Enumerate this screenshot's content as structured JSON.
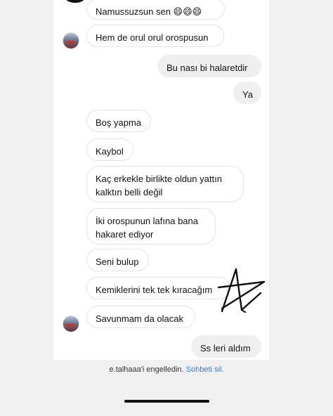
{
  "messages": [
    {
      "text": "Namussuzsun sen 😄😄😄",
      "dir": "in"
    },
    {
      "text": "Hem de orul orul orospusun",
      "dir": "in"
    },
    {
      "text": "Bu nası bi halaretdir",
      "dir": "out"
    },
    {
      "text": "Ya",
      "dir": "out"
    },
    {
      "text": "Boş yapma",
      "dir": "in"
    },
    {
      "text": "Kaybol",
      "dir": "in"
    },
    {
      "text": "Kaç erkekle birlikte oldun yattın\nkalktın belli değil",
      "dir": "in"
    },
    {
      "text": "İki orospunun lafına bana\nhakaret ediyor",
      "dir": "in"
    },
    {
      "text": "Seni bulup",
      "dir": "in"
    },
    {
      "text": "Kemiklerini tek tek kıracağım",
      "dir": "in"
    },
    {
      "text": "Savunmam da olacak",
      "dir": "in"
    },
    {
      "text": "Ss leri aldım",
      "dir": "out"
    }
  ],
  "footer": {
    "blocked_text": "e.talhaaa'i engelledin.",
    "delete_chat_label": "Sohbeti sil."
  },
  "colors": {
    "link": "#2f7de1",
    "incoming_bubble": "#ffffff",
    "outgoing_bubble": "#efefef"
  }
}
